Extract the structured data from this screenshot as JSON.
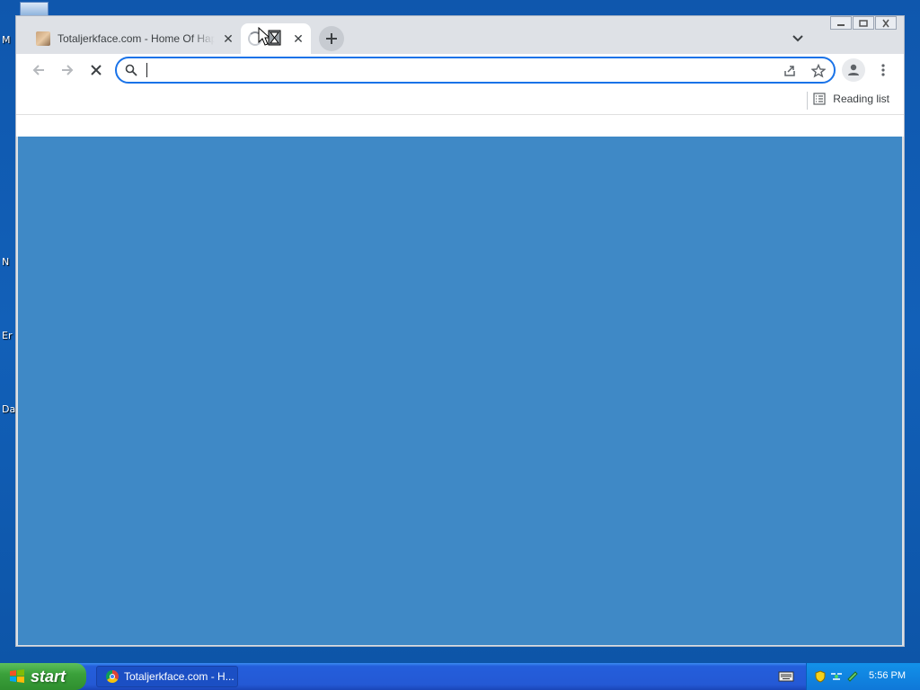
{
  "desktop": {
    "icon_labels": [
      "M",
      "N",
      "Er",
      "Da"
    ]
  },
  "browser": {
    "tabs": [
      {
        "title": "Totaljerkface.com - Home Of Happy Wheels",
        "active": false
      },
      {
        "title": "",
        "active": true,
        "loading": true
      }
    ],
    "address_bar": {
      "value": ""
    },
    "bookmarks_bar": {
      "reading_list_label": "Reading list"
    },
    "content_color": "#3f89c6"
  },
  "taskbar": {
    "start_label": "start",
    "task_button_label": "Totaljerkface.com - H...",
    "clock": "5:56 PM"
  }
}
